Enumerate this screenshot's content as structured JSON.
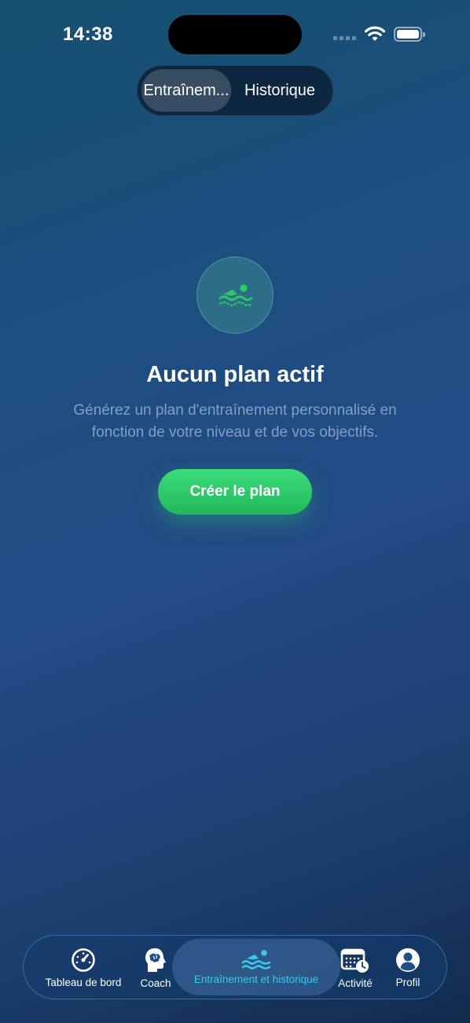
{
  "status_bar": {
    "time": "14:38"
  },
  "segmented_control": {
    "options": [
      "Entraînem...",
      "Historique"
    ],
    "selected_index": 0
  },
  "empty_state": {
    "icon": "swimmer-icon",
    "title": "Aucun plan actif",
    "description": "Générez un plan d'entraînement personnalisé en fonction de votre niveau et de vos objectifs.",
    "button_label": "Créer le plan"
  },
  "tab_bar": {
    "items": [
      {
        "label": "Tableau de bord",
        "icon": "speedometer-icon"
      },
      {
        "label": "Coach",
        "icon": "head-brain-icon"
      },
      {
        "label": "Entraînement et historique",
        "icon": "swim-waves-icon"
      },
      {
        "label": "Activité",
        "icon": "calendar-clock-icon"
      },
      {
        "label": "Profil",
        "icon": "person-circle-icon"
      }
    ],
    "selected_index": 2
  },
  "colors": {
    "accent_green": "#2bc866",
    "active_tab": "#37c9f0",
    "background_top": "#16506f",
    "background_bottom": "#122b4d"
  }
}
